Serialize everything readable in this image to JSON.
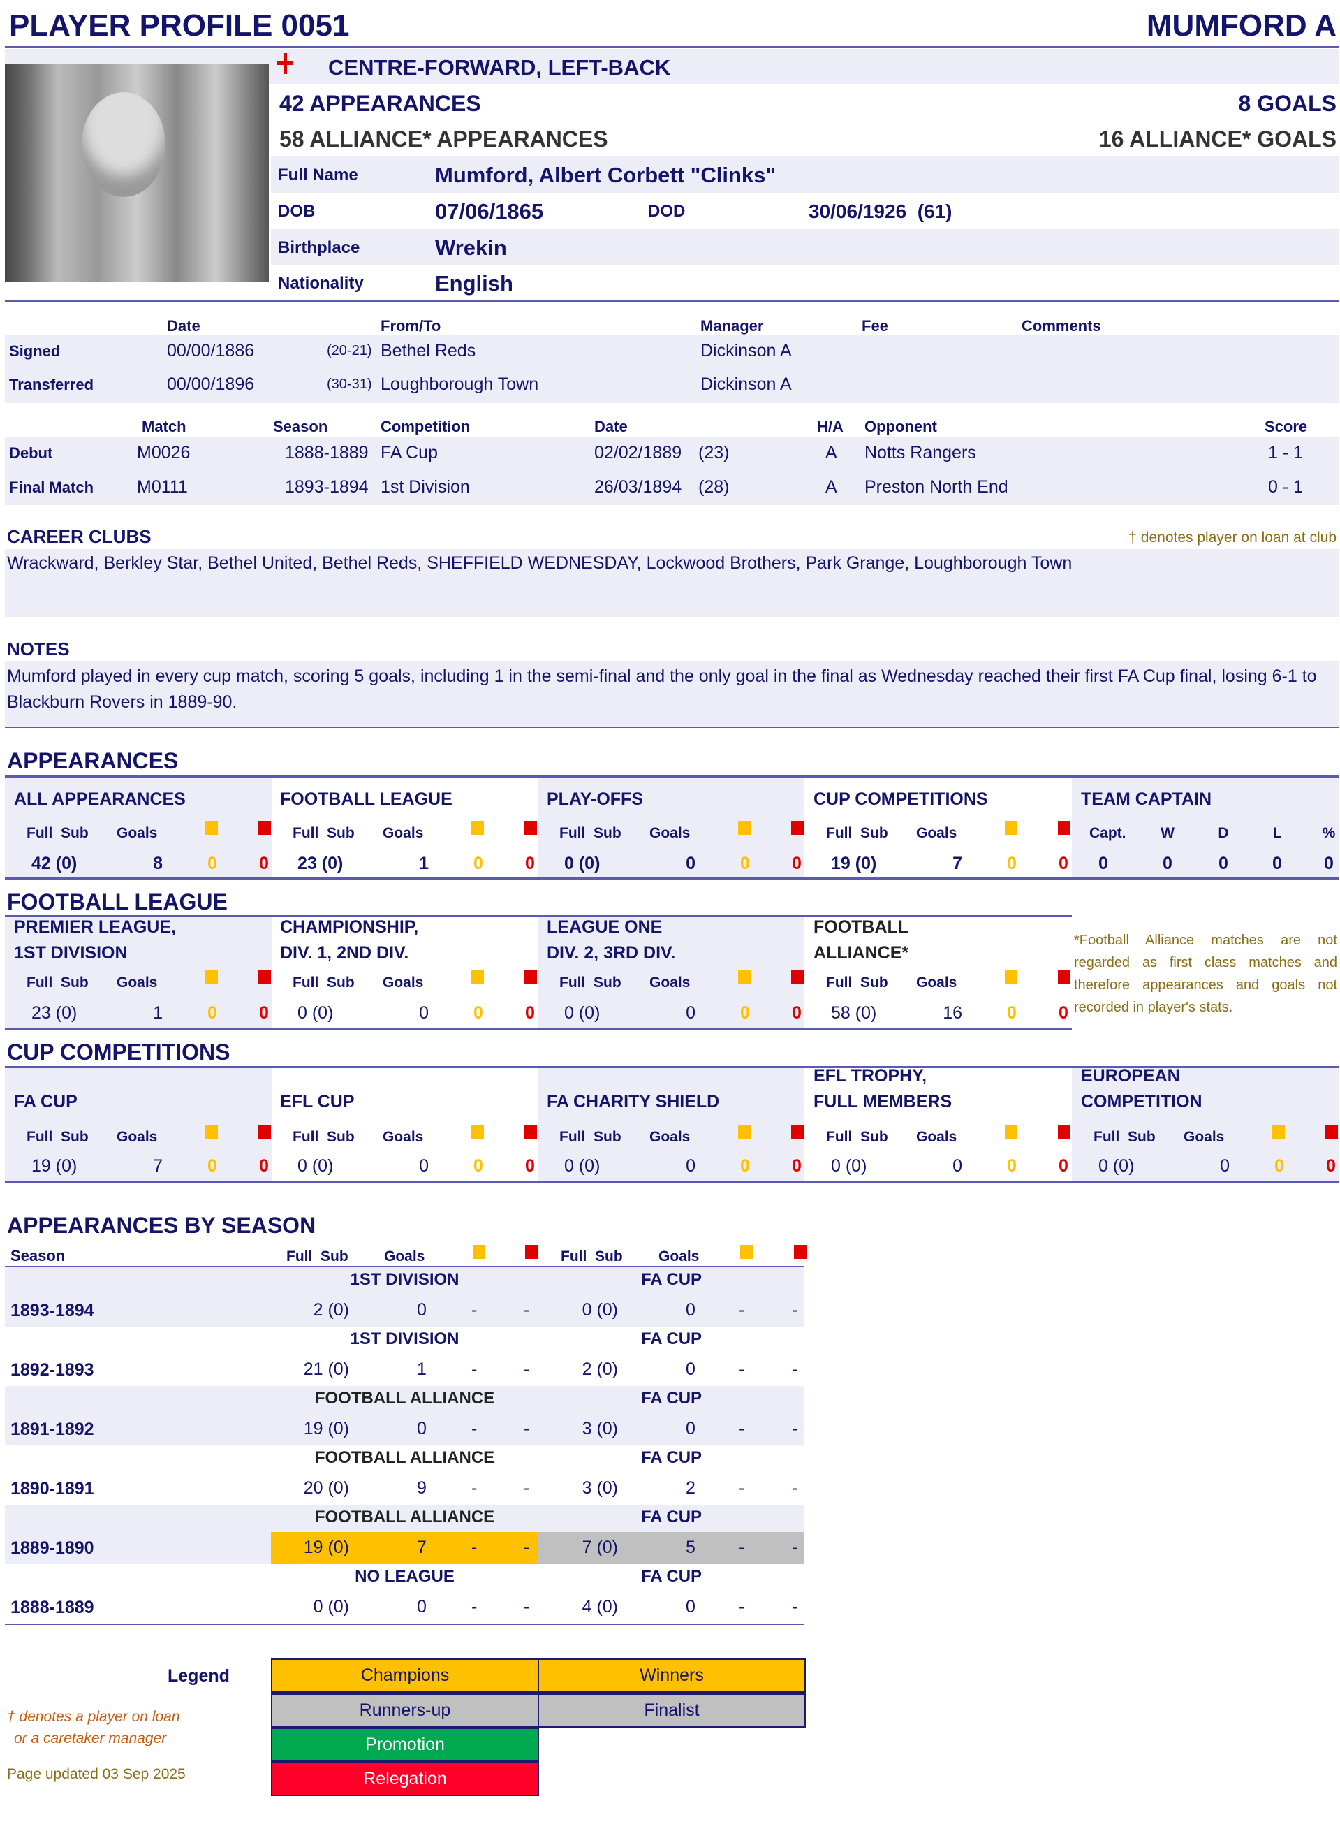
{
  "header": {
    "title": "PLAYER PROFILE 0051",
    "name": "MUMFORD A"
  },
  "profile": {
    "position": "CENTRE-FORWARD, LEFT-BACK",
    "flag_icon": "england-flag-icon",
    "appearances": "42 APPEARANCES",
    "goals": "8 GOALS",
    "alliance_appearances": "58 ALLIANCE* APPEARANCES",
    "alliance_goals": "16 ALLIANCE* GOALS",
    "full_name_label": "Full Name",
    "full_name": "Mumford, Albert Corbett \"Clinks\"",
    "dob_label": "DOB",
    "dob": "07/06/1865",
    "dod_label": "DOD",
    "dod": "30/06/1926  (61)",
    "birthplace_label": "Birthplace",
    "birthplace": "Wrekin",
    "nationality_label": "Nationality",
    "nationality": "English"
  },
  "transfers": {
    "headers": {
      "date": "Date",
      "club": "From/To",
      "manager": "Manager",
      "fee": "Fee",
      "comments": "Comments"
    },
    "rows": [
      {
        "label": "Signed",
        "date": "00/00/1886",
        "age": "(20-21)",
        "club": "Bethel Reds",
        "manager": "Dickinson A"
      },
      {
        "label": "Transferred",
        "date": "00/00/1896",
        "age": "(30-31)",
        "club": "Loughborough Town",
        "manager": "Dickinson A"
      }
    ]
  },
  "matches": {
    "headers": {
      "match": "Match",
      "season": "Season",
      "competition": "Competition",
      "date": "Date",
      "ha": "H/A",
      "opponent": "Opponent",
      "score": "Score"
    },
    "rows": [
      {
        "label": "Debut",
        "match": "M0026",
        "season": "1888-1889",
        "competition": "FA Cup",
        "date": "02/02/1889",
        "age": "(23)",
        "ha": "A",
        "opponent": "Notts Rangers",
        "score": "1 - 1"
      },
      {
        "label": "Final Match",
        "match": "M0111",
        "season": "1893-1894",
        "competition": "1st Division",
        "date": "26/03/1894",
        "age": "(28)",
        "ha": "A",
        "opponent": "Preston North End",
        "score": "0 - 1"
      }
    ]
  },
  "career": {
    "heading": "CAREER CLUBS",
    "loan_note": "† denotes player on loan at club",
    "clubs": "Wrackward, Berkley Star, Bethel United, Bethel Reds, SHEFFIELD WEDNESDAY, Lockwood Brothers, Park Grange, Loughborough Town"
  },
  "notes": {
    "heading": "NOTES",
    "text": "Mumford played in every cup match, scoring 5 goals, including 1 in the semi-final and the only goal in the final as Wednesday reached their first FA Cup final, losing 6-1 to Blackburn Rovers in 1889-90."
  },
  "labels": {
    "full_sub": "Full  Sub",
    "goals": "Goals"
  },
  "appearances": {
    "heading": "APPEARANCES",
    "panels": [
      {
        "title": [
          "ALL APPEARANCES"
        ],
        "full_sub": "42 (0)",
        "goals": "8",
        "yellow": "0",
        "red": "0",
        "bold": true
      },
      {
        "title": [
          "FOOTBALL LEAGUE"
        ],
        "full_sub": "23 (0)",
        "goals": "1",
        "yellow": "0",
        "red": "0",
        "bold": true
      },
      {
        "title": [
          "PLAY-OFFS"
        ],
        "full_sub": "0 (0)",
        "goals": "0",
        "yellow": "0",
        "red": "0",
        "bold": true
      },
      {
        "title": [
          "CUP COMPETITIONS"
        ],
        "full_sub": "19 (0)",
        "goals": "7",
        "yellow": "0",
        "red": "0",
        "bold": true
      }
    ],
    "captain": {
      "title": "TEAM CAPTAIN",
      "headers": [
        "Capt.",
        "W",
        "D",
        "L",
        "%"
      ],
      "values": [
        "0",
        "0",
        "0",
        "0",
        "0"
      ]
    }
  },
  "football_league": {
    "heading": "FOOTBALL LEAGUE",
    "panels": [
      {
        "title": [
          "PREMIER LEAGUE,",
          "1ST DIVISION"
        ],
        "full_sub": "23 (0)",
        "goals": "1",
        "yellow": "0",
        "red": "0"
      },
      {
        "title": [
          "CHAMPIONSHIP,",
          "DIV. 1, 2ND DIV."
        ],
        "full_sub": "0 (0)",
        "goals": "0",
        "yellow": "0",
        "red": "0"
      },
      {
        "title": [
          "LEAGUE ONE",
          "DIV. 2, 3RD DIV."
        ],
        "full_sub": "0 (0)",
        "goals": "0",
        "yellow": "0",
        "red": "0"
      },
      {
        "title": [
          "FOOTBALL",
          "ALLIANCE*"
        ],
        "full_sub": "58 (0)",
        "goals": "16",
        "yellow": "0",
        "red": "0",
        "dark": true
      }
    ],
    "footnote": "*Football Alliance matches are not regarded as first class matches and therefore appearances and goals not recorded in player's stats."
  },
  "cup_competitions": {
    "heading": "CUP COMPETITIONS",
    "panels": [
      {
        "title": [
          "FA CUP"
        ],
        "full_sub": "19 (0)",
        "goals": "7",
        "yellow": "0",
        "red": "0"
      },
      {
        "title": [
          "EFL CUP"
        ],
        "full_sub": "0 (0)",
        "goals": "0",
        "yellow": "0",
        "red": "0"
      },
      {
        "title": [
          "FA CHARITY SHIELD"
        ],
        "full_sub": "0 (0)",
        "goals": "0",
        "yellow": "0",
        "red": "0"
      },
      {
        "title": [
          "EFL TROPHY,",
          "FULL MEMBERS"
        ],
        "full_sub": "0 (0)",
        "goals": "0",
        "yellow": "0",
        "red": "0"
      },
      {
        "title": [
          "EUROPEAN",
          "COMPETITION"
        ],
        "full_sub": "0 (0)",
        "goals": "0",
        "yellow": "0",
        "red": "0"
      }
    ]
  },
  "by_season": {
    "heading": "APPEARANCES BY SEASON",
    "season_label": "Season",
    "seasons": [
      {
        "season": "1893-1894",
        "league": "1ST DIVISION",
        "l_fs": "2 (0)",
        "l_goals": "0",
        "l_y": "-",
        "l_r": "-",
        "cup": "FA CUP",
        "c_fs": "0 (0)",
        "c_goals": "0",
        "c_y": "-",
        "c_r": "-"
      },
      {
        "season": "1892-1893",
        "league": "1ST DIVISION",
        "l_fs": "21 (0)",
        "l_goals": "1",
        "l_y": "-",
        "l_r": "-",
        "cup": "FA CUP",
        "c_fs": "2 (0)",
        "c_goals": "0",
        "c_y": "-",
        "c_r": "-"
      },
      {
        "season": "1891-1892",
        "league": "FOOTBALL ALLIANCE",
        "l_fs": "19 (0)",
        "l_goals": "0",
        "l_y": "-",
        "l_r": "-",
        "cup": "FA CUP",
        "c_fs": "3 (0)",
        "c_goals": "0",
        "c_y": "-",
        "c_r": "-",
        "dark": true
      },
      {
        "season": "1890-1891",
        "league": "FOOTBALL ALLIANCE",
        "l_fs": "20 (0)",
        "l_goals": "9",
        "l_y": "-",
        "l_r": "-",
        "cup": "FA CUP",
        "c_fs": "3 (0)",
        "c_goals": "2",
        "c_y": "-",
        "c_r": "-",
        "dark": true
      },
      {
        "season": "1889-1890",
        "league": "FOOTBALL ALLIANCE",
        "l_fs": "19 (0)",
        "l_goals": "7",
        "l_y": "-",
        "l_r": "-",
        "cup": "FA CUP",
        "c_fs": "7 (0)",
        "c_goals": "5",
        "c_y": "-",
        "c_r": "-",
        "dark": true,
        "l_highlight": "#ffc000",
        "c_highlight": "#c0c0c0"
      },
      {
        "season": "1888-1889",
        "league": "NO LEAGUE",
        "l_fs": "0 (0)",
        "l_goals": "0",
        "l_y": "-",
        "l_r": "-",
        "cup": "FA CUP",
        "c_fs": "4 (0)",
        "c_goals": "0",
        "c_y": "-",
        "c_r": "-"
      }
    ]
  },
  "legend": {
    "label": "Legend",
    "items": [
      {
        "text": "Champions",
        "color": "#ffc000"
      },
      {
        "text": "Winners",
        "color": "#ffc000"
      },
      {
        "text": "Runners-up",
        "color": "#c0c0c0"
      },
      {
        "text": "Finalist",
        "color": "#c0c0c0"
      },
      {
        "text": "Promotion",
        "color": "#00a850"
      },
      {
        "text": "Relegation",
        "color": "#ff0028"
      }
    ],
    "loan_note_1": "† denotes a player on loan",
    "loan_note_2": "or a caretaker manager",
    "updated": "Page updated 03 Sep 2025"
  }
}
